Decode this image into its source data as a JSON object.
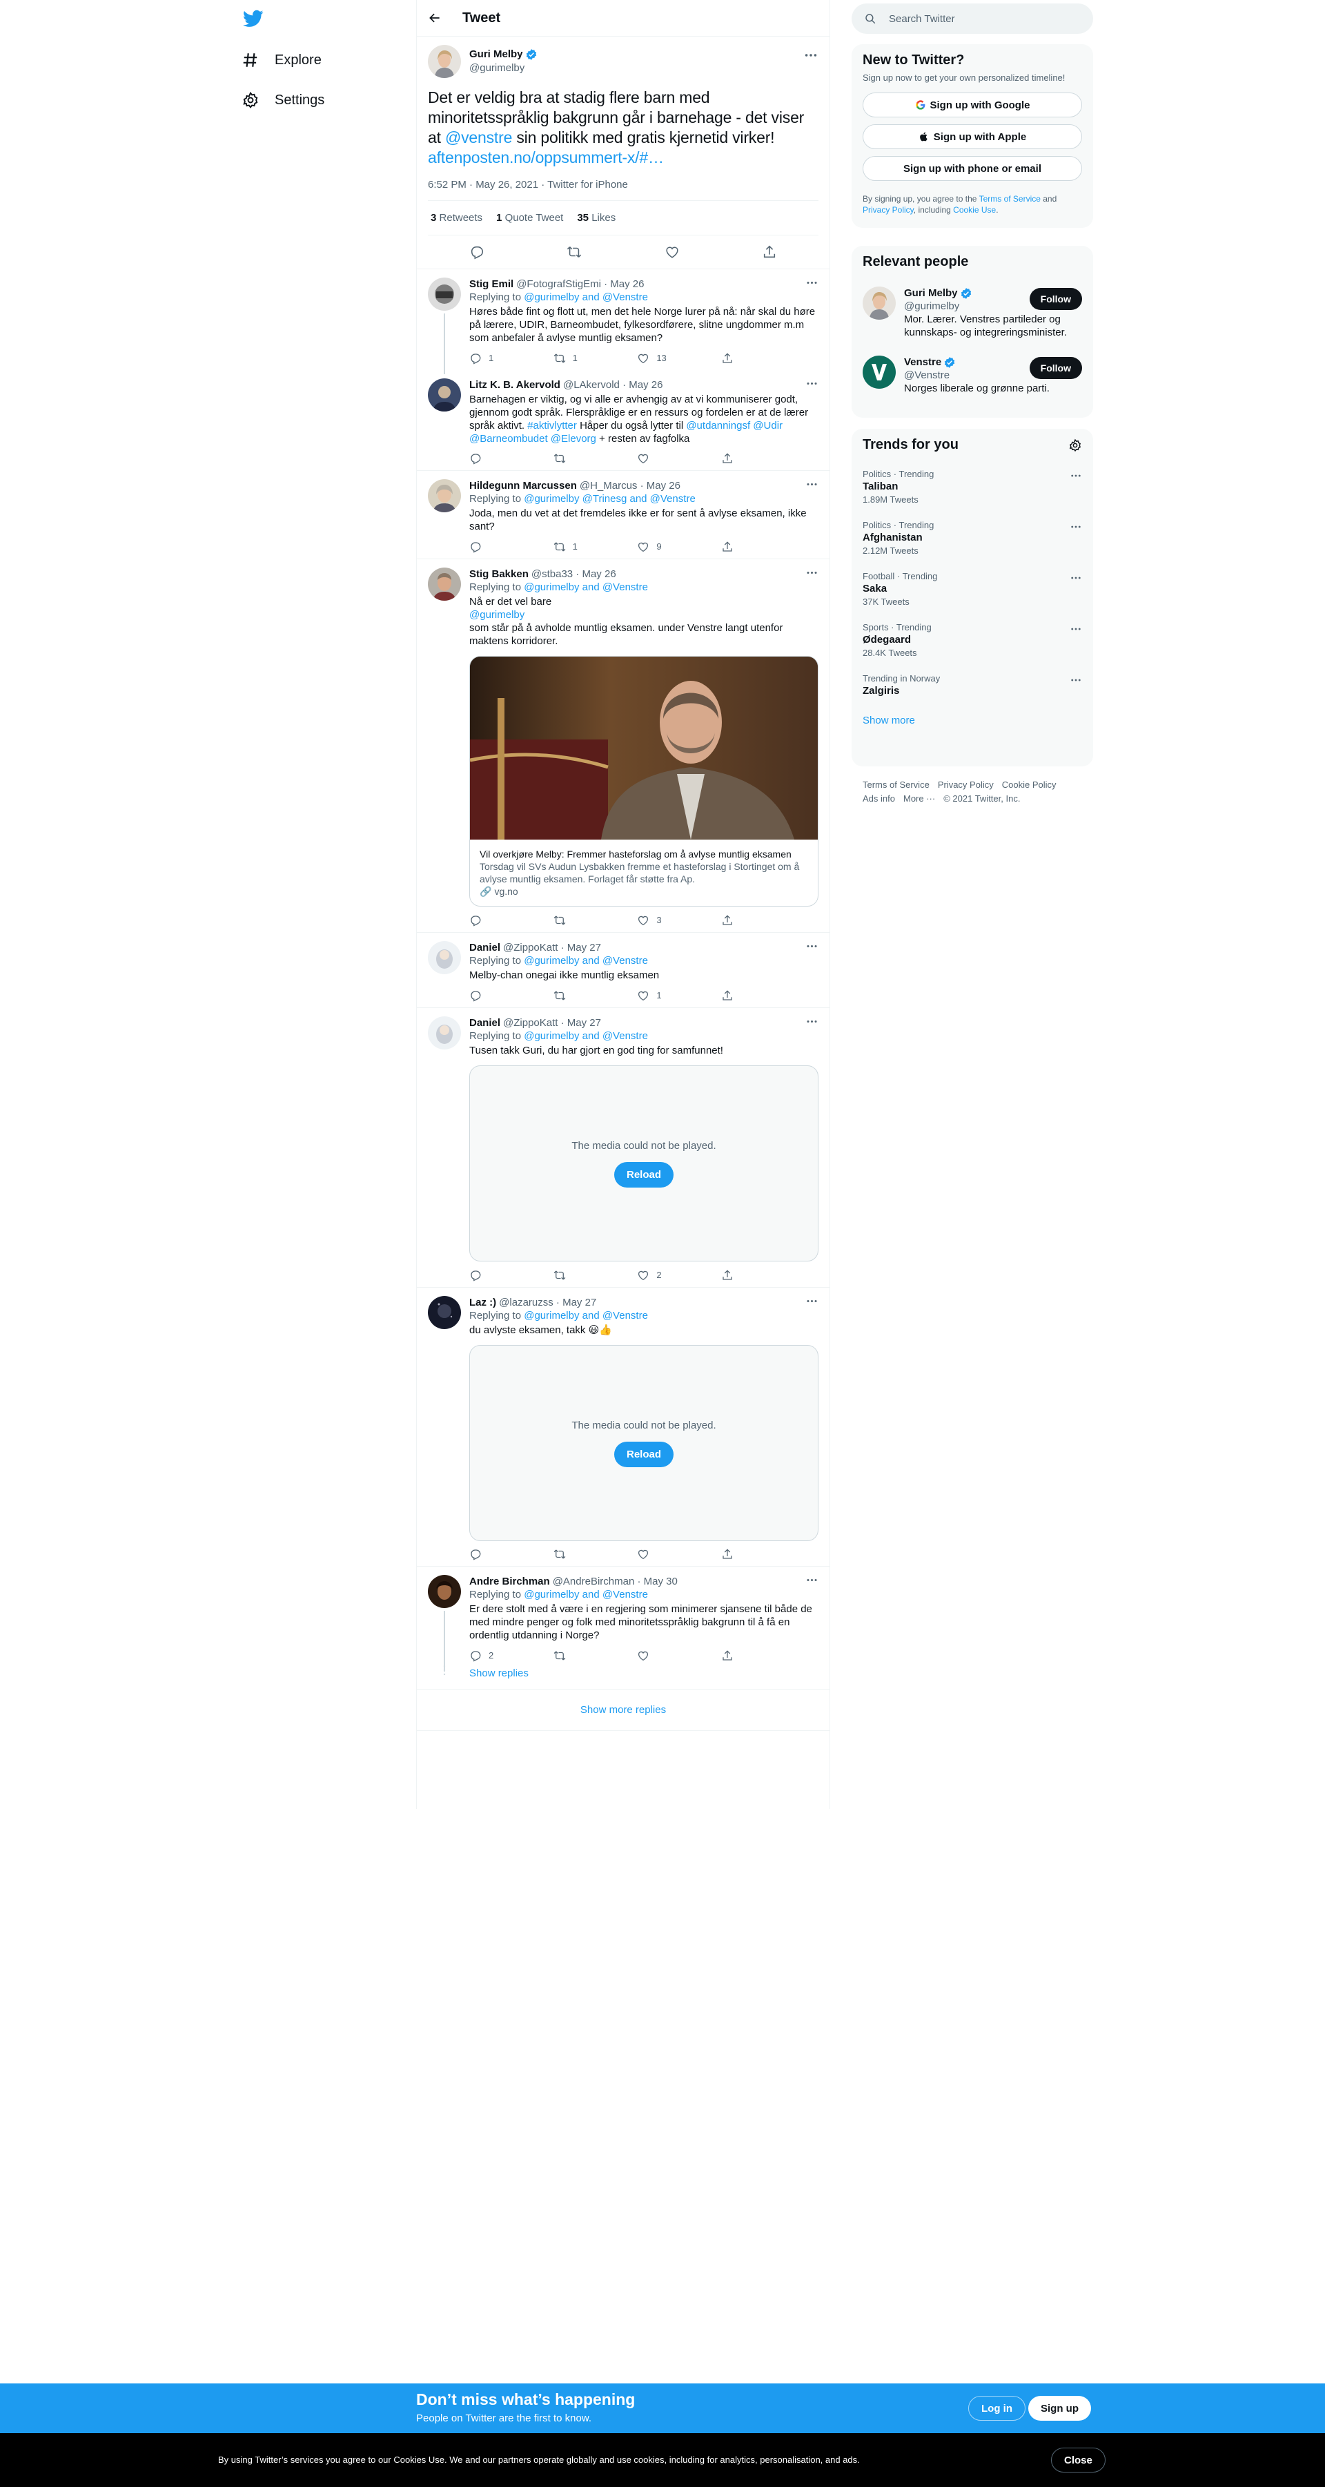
{
  "nav": {
    "explore": "Explore",
    "settings": "Settings"
  },
  "header": {
    "title": "Tweet"
  },
  "focal": {
    "name": "Guri Melby",
    "handle": "@gurimelby",
    "text_a": "Det er veldig bra at stadig flere barn med minoritetsspråklig bakgrunn går i barnehage - det viser at ",
    "mention": "@venstre",
    "text_b": " sin politikk med gratis kjernetid virker! ",
    "link": "aftenposten.no/oppsummert-x/#…",
    "time": "6:52 PM · May 26, 2021 · Twitter for iPhone",
    "retweets": "3",
    "retweets_label": "Retweets",
    "quotes": "1",
    "quotes_label": "Quote Tweet",
    "likes": "35",
    "likes_label": "Likes"
  },
  "replying_to": "Replying to",
  "replies": [
    {
      "name": "Stig Emil",
      "meta": "@FotografStigEmi · May 26",
      "mentions": "@gurimelby and @Venstre",
      "text": "Høres både fint og flott ut, men det hele Norge lurer på nå: når skal du høre på lærere, UDIR, Barneombudet, fylkesordførere, slitne ungdommer m.m som anbefaler å avlyse muntlig eksamen?",
      "replies": "1",
      "retweets": "1",
      "likes": "13"
    },
    {
      "name": "Litz K. B. Akervold",
      "meta": "@LAkervold · May 26",
      "text_a": "Barnehagen er viktig, og vi alle er avhengig av at vi kommuniserer godt, gjennom godt språk. Flerspråklige er en ressurs og fordelen er at de lærer språk aktivt. ",
      "tag": "#aktivlytter",
      "text_b": " Håper du også lytter til ",
      "links": "@utdanningsf @Udir @Barneombudet @Elevorg",
      "text_c": " + resten av fagfolka"
    },
    {
      "name": "Hildegunn Marcussen",
      "meta": "@H_Marcus · May 26",
      "mentions": "@gurimelby @Trinesg and @Venstre",
      "text": "Joda, men du vet at det fremdeles ikke er for sent å avlyse eksamen, ikke sant?",
      "retweets": "1",
      "likes": "9"
    },
    {
      "name": "Stig Bakken",
      "meta": "@stba33 · May 26",
      "mentions": "@gurimelby and @Venstre",
      "line1": "Nå er det vel bare",
      "line2": "@gurimelby",
      "line3": " som står på å avholde  muntlig eksamen. under Venstre langt utenfor maktens korridorer.",
      "card_title": "Vil overkjøre Melby: Fremmer hasteforslag om å avlyse muntlig eksamen",
      "card_desc": "Torsdag vil SVs Audun Lysbakken fremme et hasteforslag i Stortinget om å avlyse muntlig eksamen. Forlaget får støtte fra Ap.",
      "card_domain": "vg.no",
      "likes": "3"
    },
    {
      "name": "Daniel",
      "meta": "@ZippoKatt · May 27",
      "mentions": "@gurimelby and @Venstre",
      "text": "Melby-chan onegai ikke muntlig eksamen",
      "likes": "1"
    },
    {
      "name": "Daniel",
      "meta": "@ZippoKatt · May 27",
      "mentions": "@gurimelby and @Venstre",
      "text": "Tusen takk Guri, du har gjort en god ting for samfunnet!",
      "likes": "2"
    },
    {
      "name": "Laz :)",
      "meta": "@lazaruzss · May 27",
      "mentions": "@gurimelby and @Venstre",
      "text": "du avlyste eksamen, takk 😃👍"
    },
    {
      "name": "Andre Birchman",
      "meta": "@AndreBirchman · May 30",
      "mentions": "@gurimelby and @Venstre",
      "text": "Er dere stolt med å være i en regjering som minimerer sjansene til både de med mindre penger og folk med minoritetsspråklig bakgrunn til å få en ordentlig utdanning i Norge?",
      "replies": "2"
    }
  ],
  "media_error": "The media could not be played.",
  "reload": "Reload",
  "show_replies": "Show replies",
  "show_more_replies": "Show more replies",
  "search": {
    "placeholder": "Search Twitter"
  },
  "signup": {
    "title": "New to Twitter?",
    "sub": "Sign up now to get your own personalized timeline!",
    "google": "Sign up with Google",
    "apple": "Sign up with Apple",
    "phone": "Sign up with phone or email",
    "legal_a": "By signing up, you agree to the ",
    "terms": "Terms of Service",
    "legal_b": " and ",
    "privacy": "Privacy Policy",
    "legal_c": ", including ",
    "cookie": "Cookie Use",
    "legal_d": "."
  },
  "relevant": {
    "title": "Relevant people",
    "follow": "Follow",
    "people": [
      {
        "name": "Guri Melby",
        "handle": "@gurimelby",
        "bio": "Mor. Lærer. Venstres partileder og kunnskaps- og integreringsminister."
      },
      {
        "name": "Venstre",
        "handle": "@Venstre",
        "bio": "Norges liberale og grønne parti."
      }
    ]
  },
  "trends": {
    "title": "Trends for you",
    "items": [
      {
        "cat": "Politics · Trending",
        "name": "Taliban",
        "count": "1.89M Tweets"
      },
      {
        "cat": "Politics · Trending",
        "name": "Afghanistan",
        "count": "2.12M Tweets"
      },
      {
        "cat": "Football · Trending",
        "name": "Saka",
        "count": "37K Tweets"
      },
      {
        "cat": "Sports · Trending",
        "name": "Ødegaard",
        "count": "28.4K Tweets"
      },
      {
        "cat": "Trending in Norway",
        "name": "Zalgiris",
        "count": ""
      }
    ],
    "show_more": "Show more"
  },
  "footer": {
    "terms": "Terms of Service",
    "privacy": "Privacy Policy",
    "cookie": "Cookie Policy",
    "ads": "Ads info",
    "more": "More ···",
    "copy": "© 2021 Twitter, Inc."
  },
  "bottombar": {
    "title": "Don’t miss what’s happening",
    "sub": "People on Twitter are the first to know.",
    "login": "Log in",
    "signup": "Sign up"
  },
  "cookiebar": {
    "text": "By using Twitter’s services you agree to our Cookies Use. We and our partners operate globally and use cookies, including for analytics, personalisation, and ads.",
    "close": "Close"
  },
  "colors": {
    "accent": "#1d9bf0",
    "text": "#0f1419",
    "muted": "#536471"
  }
}
